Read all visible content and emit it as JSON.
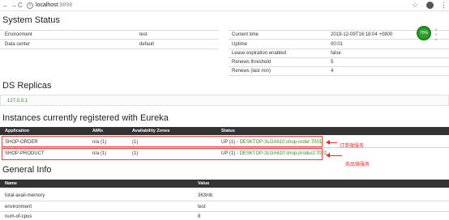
{
  "browser": {
    "back": "←",
    "forward": "→",
    "reload": "C",
    "info": "i",
    "host": "localhost",
    "port": ":9898",
    "star": "☆",
    "menu": "⋮"
  },
  "system_status": {
    "title": "System Status",
    "left": [
      {
        "key": "Environment",
        "value": "test"
      },
      {
        "key": "Data center",
        "value": "default"
      }
    ],
    "right": [
      {
        "key": "Current time",
        "value": "2019-12-09T16:18:04 +0800"
      },
      {
        "key": "Uptime",
        "value": "00:01"
      },
      {
        "key": "Lease expiration enabled",
        "value": "false"
      },
      {
        "key": "Renews threshold",
        "value": "5"
      },
      {
        "key": "Renews (last min)",
        "value": "4"
      }
    ]
  },
  "gauge": {
    "percent": "70%",
    "lines": [
      "0",
      "0",
      "0"
    ]
  },
  "ds_replicas": {
    "title": "DS Replicas",
    "replica": "127.0.0.1"
  },
  "instances": {
    "title": "Instances currently registered with Eureka",
    "headers": [
      "Application",
      "AMIs",
      "Availability Zones",
      "Status"
    ],
    "rows": [
      {
        "application": "SHOP-ORDER",
        "amis": "n/a (1)",
        "zones": "(1)",
        "status_prefix": "UP (1) - ",
        "status_link": "DESKTOP-3LGA610:shop-order:7001"
      },
      {
        "application": "SHOP-PRODUCT",
        "amis": "n/a (1)",
        "zones": "(1)",
        "status_prefix": "UP (1) - ",
        "status_link": "DESKTOP-3LGA610:shop-product:7002"
      }
    ],
    "annotations": [
      "订单微服务",
      "商品微服务"
    ]
  },
  "general_info": {
    "title": "General Info",
    "headers": [
      "Name",
      "Value"
    ],
    "rows": [
      {
        "name": "total-avail-memory",
        "value": "363mb"
      },
      {
        "name": "environment",
        "value": "test"
      },
      {
        "name": "num-of-cpus",
        "value": "8"
      }
    ]
  },
  "colors": {
    "accent_link": "#3a8a2e",
    "table_header": "#333333",
    "annotation": "#e03030",
    "gauge": "#2ca02c"
  }
}
